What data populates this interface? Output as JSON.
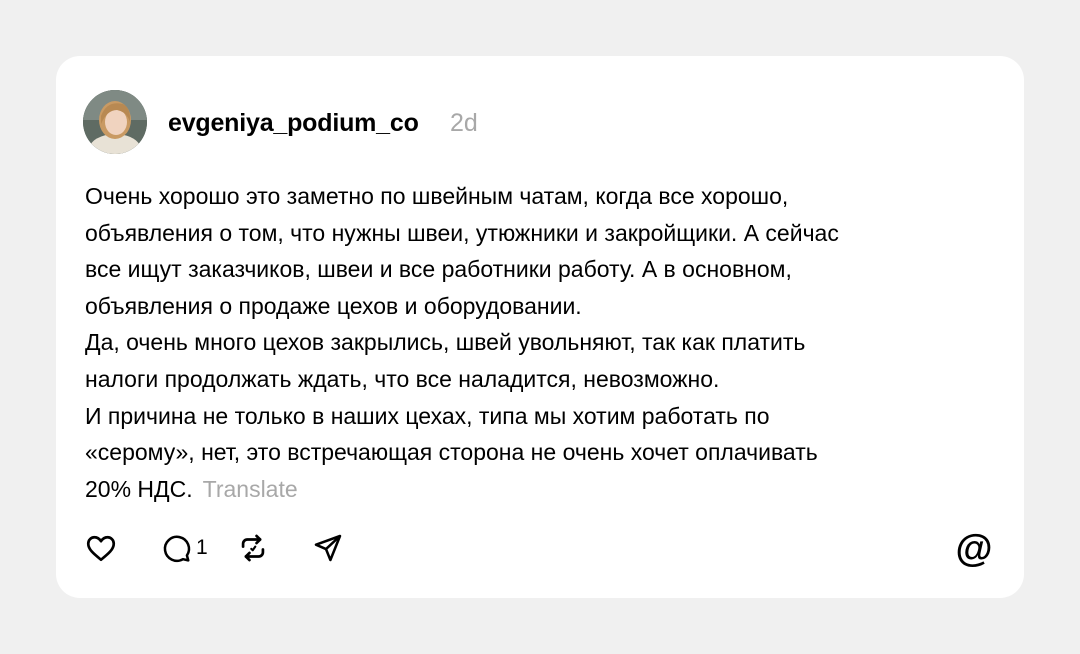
{
  "post": {
    "username": "evgeniya_podium_co",
    "time": "2d",
    "text_lines": [
      "Очень хорошо это заметно по швейным чатам, когда все хорошо,",
      "объявления о том, что нужны швеи, утюжники и закройщики. А сейчас",
      "все ищут заказчиков, швеи и все работники работу. А в основном,",
      "объявления о продаже цехов и оборудовании.",
      "Да, очень много цехов закрылись, швей увольняют, так как платить",
      "налоги продолжать ждать, что все наладится, невозможно.",
      "И причина не только в наших цехах, типа мы хотим работать по",
      "«серому», нет, это встречающая сторона не очень хочет оплачивать",
      "20% НДС."
    ],
    "translate_label": "Translate"
  },
  "actions": {
    "like_icon": "heart-icon",
    "reply_icon": "comment-icon",
    "reply_count": "1",
    "repost_icon": "repost-icon",
    "share_icon": "send-icon"
  },
  "brand": {
    "logo_icon": "threads-logo-icon",
    "logo_glyph": "@"
  },
  "colors": {
    "background": "#f0f0f0",
    "card": "#ffffff",
    "text": "#000000",
    "muted": "#a8a8a8"
  }
}
